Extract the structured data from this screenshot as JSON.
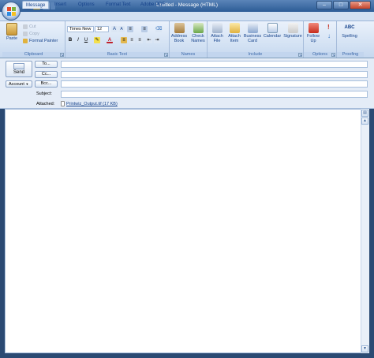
{
  "window": {
    "title": "Untitled - Message (HTML)",
    "minimize": "–",
    "maximize": "□",
    "close": "✕"
  },
  "tabs": [
    "Message",
    "Insert",
    "Options",
    "Format Text",
    "Adobe PDF"
  ],
  "clipboard": {
    "paste": "Paste",
    "cut": "Cut",
    "copy": "Copy",
    "format_painter": "Format Painter",
    "group_label": "Clipboard"
  },
  "basic_text": {
    "font": "Times New",
    "size": "12",
    "group_label": "Basic Text",
    "bold": "B",
    "italic": "I",
    "underline": "U",
    "font_color_glyph": "A"
  },
  "names": {
    "address_book": "Address Book",
    "check_names": "Check Names",
    "group_label": "Names"
  },
  "include": {
    "attach_file": "Attach File",
    "attach_item": "Attach Item",
    "business_card": "Business Card",
    "calendar": "Calendar",
    "signature": "Signature",
    "group_label": "Include"
  },
  "options": {
    "follow_up": "Follow Up",
    "group_label": "Options"
  },
  "proofing": {
    "spelling": "Spelling",
    "spelling_glyph": "ABC",
    "group_label": "Proofing"
  },
  "header": {
    "send": "Send",
    "to": "To...",
    "cc": "Cc...",
    "account": "Account",
    "bcc": "Bcc...",
    "subject_label": "Subject:",
    "attached_label": "Attached:",
    "attachment": "Printwiz_Output.tif (17 KB)",
    "to_value": "",
    "cc_value": "",
    "bcc_value": "",
    "subject_value": ""
  },
  "colors": {
    "ribbon": "#d5e3f4",
    "title_bar": "#2c5c96",
    "accent_text": "#15428b"
  }
}
